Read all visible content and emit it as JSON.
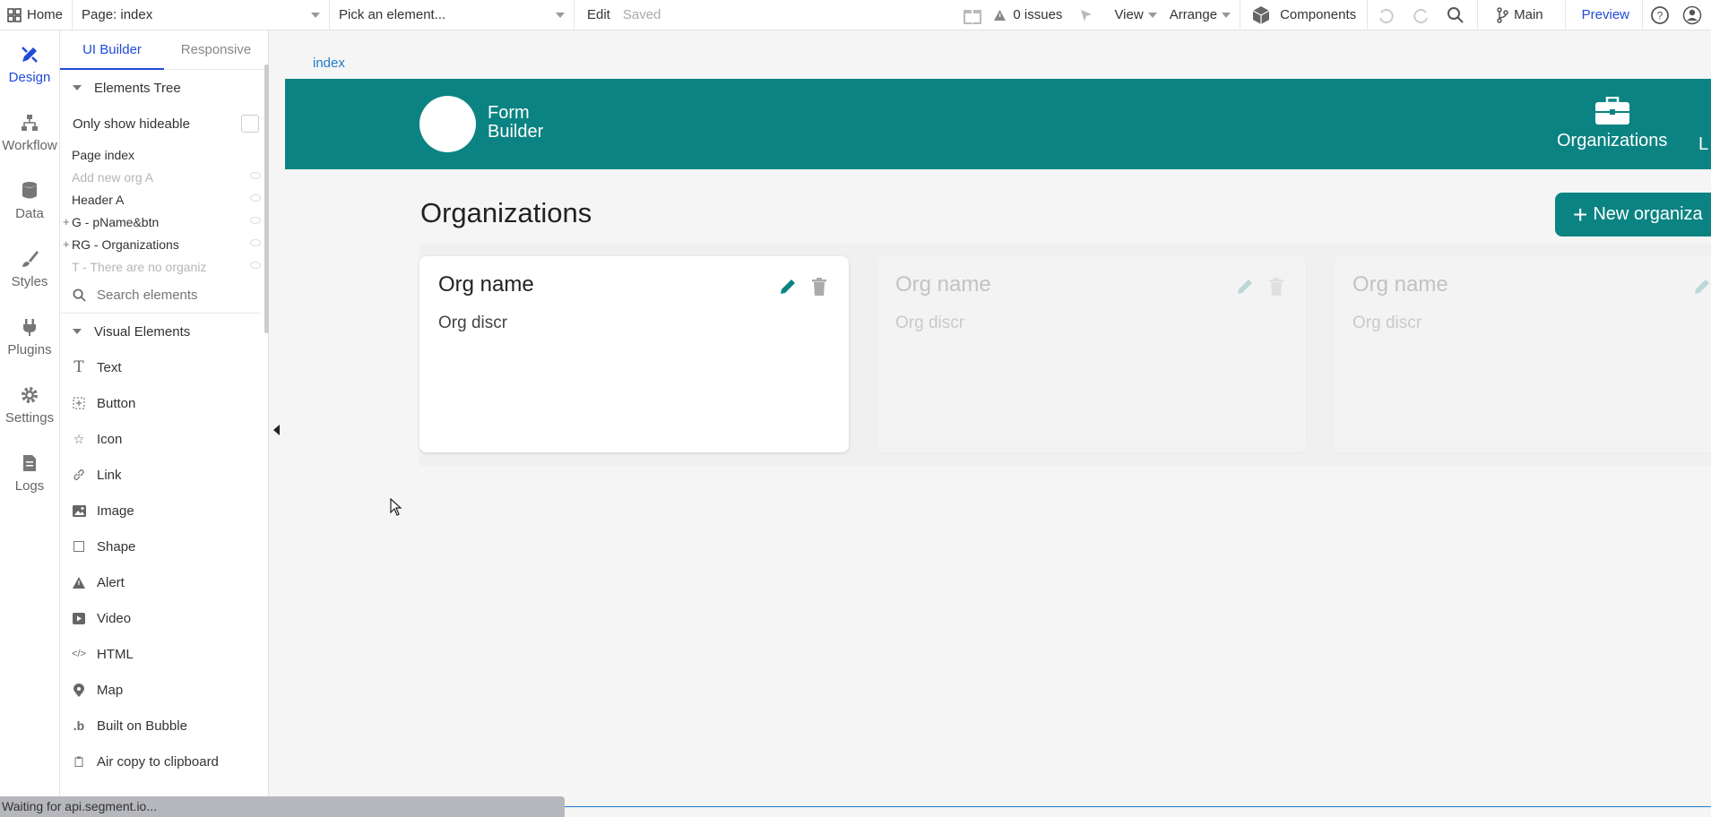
{
  "topbar": {
    "home": "Home",
    "page_select": "Page: index",
    "element_picker": "Pick an element...",
    "edit": "Edit",
    "saved": "Saved",
    "issues": "0 issues",
    "view": "View",
    "arrange": "Arrange",
    "components": "Components",
    "branch": "Main",
    "preview": "Preview"
  },
  "leftnav": [
    {
      "label": "Design",
      "icon": "design-icon"
    },
    {
      "label": "Workflow",
      "icon": "workflow-icon"
    },
    {
      "label": "Data",
      "icon": "database-icon"
    },
    {
      "label": "Styles",
      "icon": "brush-icon"
    },
    {
      "label": "Plugins",
      "icon": "plug-icon"
    },
    {
      "label": "Settings",
      "icon": "gear-icon"
    },
    {
      "label": "Logs",
      "icon": "document-icon"
    }
  ],
  "panel": {
    "tabs": [
      "UI Builder",
      "Responsive"
    ],
    "elements_tree": "Elements Tree",
    "only_hideable": "Only show hideable",
    "tree": [
      "Page index",
      "Add new org A",
      "Header A",
      "G - pName&btn",
      "RG - Organizations",
      "T - There are no organiz"
    ],
    "search_placeholder": "Search elements",
    "visual_elements": "Visual Elements",
    "elements": [
      "Text",
      "Button",
      "Icon",
      "Link",
      "Image",
      "Shape",
      "Alert",
      "Video",
      "HTML",
      "Map",
      "Built on Bubble",
      "Air copy to clipboard"
    ]
  },
  "canvas": {
    "breadcrumb": "index",
    "logo_line1": "Form",
    "logo_line2": "Builder",
    "nav_link": "Organizations",
    "nav_link_cut": "L",
    "heading": "Organizations",
    "new_button": "New organiza",
    "cards": [
      {
        "name": "Org name",
        "desc": "Org discr"
      },
      {
        "name": "Org name",
        "desc": "Org discr"
      },
      {
        "name": "Org name",
        "desc": "Org discr"
      }
    ]
  },
  "status": "Waiting for api.segment.io...",
  "colors": {
    "brand": "#0b8382",
    "accent": "#1f4bd8"
  }
}
